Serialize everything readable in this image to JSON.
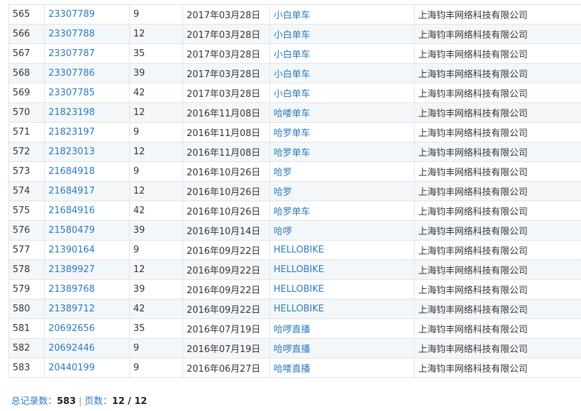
{
  "rows": [
    {
      "idx": "565",
      "reg": "23307789",
      "cls": "9",
      "date": "2017年03月28日",
      "name": "小白单车",
      "applicant": "上海钧丰网络科技有限公司"
    },
    {
      "idx": "566",
      "reg": "23307788",
      "cls": "12",
      "date": "2017年03月28日",
      "name": "小白单车",
      "applicant": "上海钧丰网络科技有限公司"
    },
    {
      "idx": "567",
      "reg": "23307787",
      "cls": "35",
      "date": "2017年03月28日",
      "name": "小白单车",
      "applicant": "上海钧丰网络科技有限公司"
    },
    {
      "idx": "568",
      "reg": "23307786",
      "cls": "39",
      "date": "2017年03月28日",
      "name": "小白单车",
      "applicant": "上海钧丰网络科技有限公司"
    },
    {
      "idx": "569",
      "reg": "23307785",
      "cls": "42",
      "date": "2017年03月28日",
      "name": "小白单车",
      "applicant": "上海钧丰网络科技有限公司"
    },
    {
      "idx": "570",
      "reg": "21823198",
      "cls": "12",
      "date": "2016年11月08日",
      "name": "哈喽单车",
      "applicant": "上海钧丰网络科技有限公司"
    },
    {
      "idx": "571",
      "reg": "21823197",
      "cls": "9",
      "date": "2016年11月08日",
      "name": "哈罗单车",
      "applicant": "上海钧丰网络科技有限公司"
    },
    {
      "idx": "572",
      "reg": "21823013",
      "cls": "12",
      "date": "2016年11月08日",
      "name": "哈罗单车",
      "applicant": "上海钧丰网络科技有限公司"
    },
    {
      "idx": "573",
      "reg": "21684918",
      "cls": "9",
      "date": "2016年10月26日",
      "name": "哈罗",
      "applicant": "上海钧丰网络科技有限公司"
    },
    {
      "idx": "574",
      "reg": "21684917",
      "cls": "12",
      "date": "2016年10月26日",
      "name": "哈罗",
      "applicant": "上海钧丰网络科技有限公司"
    },
    {
      "idx": "575",
      "reg": "21684916",
      "cls": "42",
      "date": "2016年10月26日",
      "name": "哈罗单车",
      "applicant": "上海钧丰网络科技有限公司"
    },
    {
      "idx": "576",
      "reg": "21580479",
      "cls": "39",
      "date": "2016年10月14日",
      "name": "哈啰",
      "applicant": "上海钧丰网络科技有限公司"
    },
    {
      "idx": "577",
      "reg": "21390164",
      "cls": "9",
      "date": "2016年09月22日",
      "name": "HELLOBIKE",
      "applicant": "上海钧丰网络科技有限公司"
    },
    {
      "idx": "578",
      "reg": "21389927",
      "cls": "12",
      "date": "2016年09月22日",
      "name": "HELLOBIKE",
      "applicant": "上海钧丰网络科技有限公司"
    },
    {
      "idx": "579",
      "reg": "21389768",
      "cls": "39",
      "date": "2016年09月22日",
      "name": "HELLOBIKE",
      "applicant": "上海钧丰网络科技有限公司"
    },
    {
      "idx": "580",
      "reg": "21389712",
      "cls": "42",
      "date": "2016年09月22日",
      "name": "HELLOBIKE",
      "applicant": "上海钧丰网络科技有限公司"
    },
    {
      "idx": "581",
      "reg": "20692656",
      "cls": "35",
      "date": "2016年07月19日",
      "name": "哈啰直播",
      "applicant": "上海钧丰网络科技有限公司"
    },
    {
      "idx": "582",
      "reg": "20692446",
      "cls": "9",
      "date": "2016年07月19日",
      "name": "哈啰直播",
      "applicant": "上海钧丰网络科技有限公司"
    },
    {
      "idx": "583",
      "reg": "20440199",
      "cls": "9",
      "date": "2016年06月27日",
      "name": "哈喽直播",
      "applicant": "上海钧丰网络科技有限公司"
    }
  ],
  "footer": {
    "total_label": "总记录数：",
    "total_value": "583",
    "separator": "|",
    "page_label": "页数：",
    "page_value": "12 / 12"
  },
  "colors": {
    "link": "#2a7ac0",
    "row_alt": "#f4f7fa",
    "border": "#dfe3e8"
  }
}
